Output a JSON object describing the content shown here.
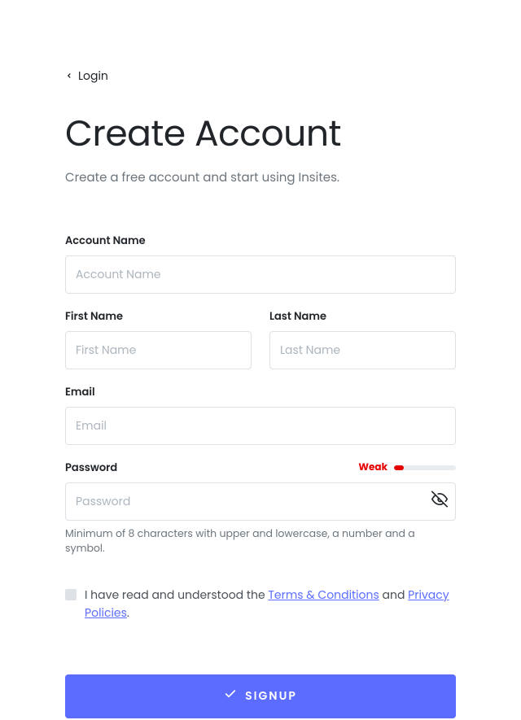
{
  "nav": {
    "back_label": "Login"
  },
  "header": {
    "title": "Create Account",
    "subtitle": "Create a free account and start using Insites."
  },
  "fields": {
    "account_name": {
      "label": "Account Name",
      "placeholder": "Account Name"
    },
    "first_name": {
      "label": "First Name",
      "placeholder": "First Name"
    },
    "last_name": {
      "label": "Last Name",
      "placeholder": "Last Name"
    },
    "email": {
      "label": "Email",
      "placeholder": "Email"
    },
    "password": {
      "label": "Password",
      "placeholder": "Password",
      "strength_label": "Weak",
      "strength_color": "#e60000",
      "strength_percent": 16,
      "helper": "Minimum of 8 characters with upper and lowercase, a number and a symbol."
    }
  },
  "terms": {
    "prefix": "I have read and understood the ",
    "terms_link": "Terms & Conditions",
    "middle": " and ",
    "privacy_link": "Privacy Policies",
    "suffix": "."
  },
  "actions": {
    "signup_label": "SIGNUP"
  }
}
